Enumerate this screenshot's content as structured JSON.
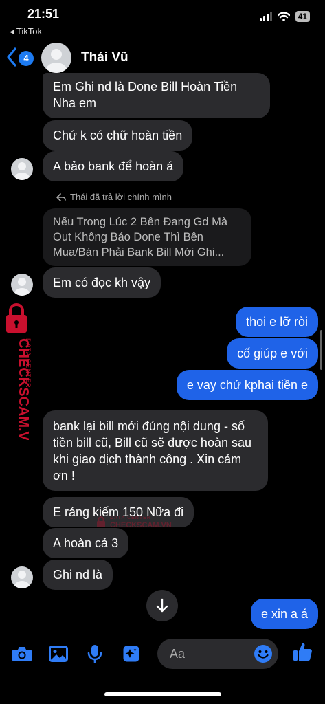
{
  "status_bar": {
    "time": "21:51",
    "back_app": "◂ TikTok",
    "battery": "41"
  },
  "header": {
    "unread_count": "4",
    "contact_name": "Thái Vũ"
  },
  "messages": [
    {
      "side": "in",
      "text": "Em Ghi nd là Done Bill Hoàn Tiền Nha em"
    },
    {
      "side": "in",
      "text": "Chứ k có chữ hoàn tiền"
    },
    {
      "side": "in",
      "text": "A bảo bank để hoàn á"
    },
    {
      "side": "reply_note",
      "text": "Thái đã trả lời chính mình"
    },
    {
      "side": "reply_ref",
      "text": "Nếu Trong Lúc 2 Bên Đang Gd Mà Out Không Báo Done Thì Bên Mua/Bán Phải Bank Bill Mới Ghi..."
    },
    {
      "side": "in",
      "text": "Em có đọc kh vậy"
    },
    {
      "side": "out",
      "text": "thoi e lỡ ròi"
    },
    {
      "side": "out",
      "text": "cố giúp e với"
    },
    {
      "side": "out",
      "text": "e vay chứ kphai tiền e"
    },
    {
      "side": "in",
      "text": "bank lại bill mới đúng nội dung - số tiền bill cũ, Bill cũ sẽ được hoàn sau khi giao dịch thành công . Xin cảm ơn !"
    },
    {
      "side": "in",
      "text": "E ráng kiếm 150 Nữa đi"
    },
    {
      "side": "in",
      "text": "A hoàn cả 3"
    },
    {
      "side": "in",
      "text": "Ghi nd là"
    },
    {
      "side": "out",
      "text": "e xin a á"
    }
  ],
  "watermark": {
    "brand": "CHECKSCAM.VN",
    "tagline": "DATA CENTER"
  },
  "composer": {
    "placeholder": "Aa"
  },
  "colors": {
    "background": "#000000",
    "incoming_bubble": "#2b2b2e",
    "outgoing_bubble": "#1f63e8",
    "accent": "#1d7bf2",
    "watermark": "#c8102e"
  },
  "icons": [
    "chevron-left-icon",
    "camera-icon",
    "photo-icon",
    "microphone-icon",
    "sparkle-icon",
    "emoji-icon",
    "thumbs-up-icon",
    "arrow-down-icon",
    "reply-icon",
    "wifi-icon",
    "signal-icon"
  ]
}
